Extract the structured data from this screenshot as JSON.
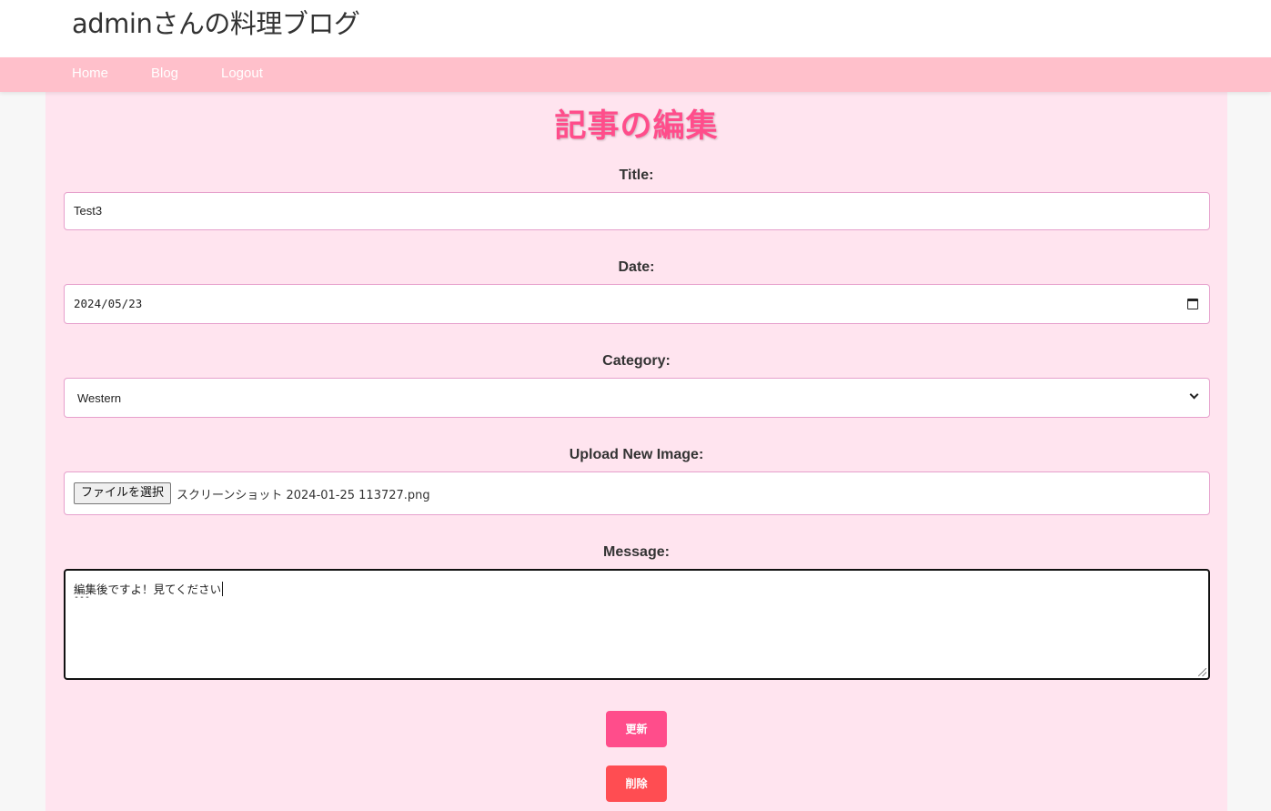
{
  "header": {
    "site_title": "adminさんの料理ブログ"
  },
  "nav": {
    "items": [
      "Home",
      "Blog",
      "Logout"
    ]
  },
  "page": {
    "heading": "記事の編集"
  },
  "form": {
    "title_label": "Title:",
    "title_value": "Test3",
    "date_label": "Date:",
    "date_value": "2024/05/23",
    "category_label": "Category:",
    "category_value": "Western",
    "image_label": "Upload New Image:",
    "file_button": "ファイルを選択",
    "file_name": "スクリーンショット 2024-01-25 113727.png",
    "message_label": "Message:",
    "message_line1": "編集後ですよ！見てください",
    "message_line2": "---",
    "update_button": "更新",
    "delete_button": "削除"
  },
  "colors": {
    "nav_bg": "#ffc0cb",
    "panel_bg": "#ffe4ef",
    "heading": "#ff4d8b",
    "update_button": "#ff4d8b",
    "delete_button": "#ff4d52"
  }
}
